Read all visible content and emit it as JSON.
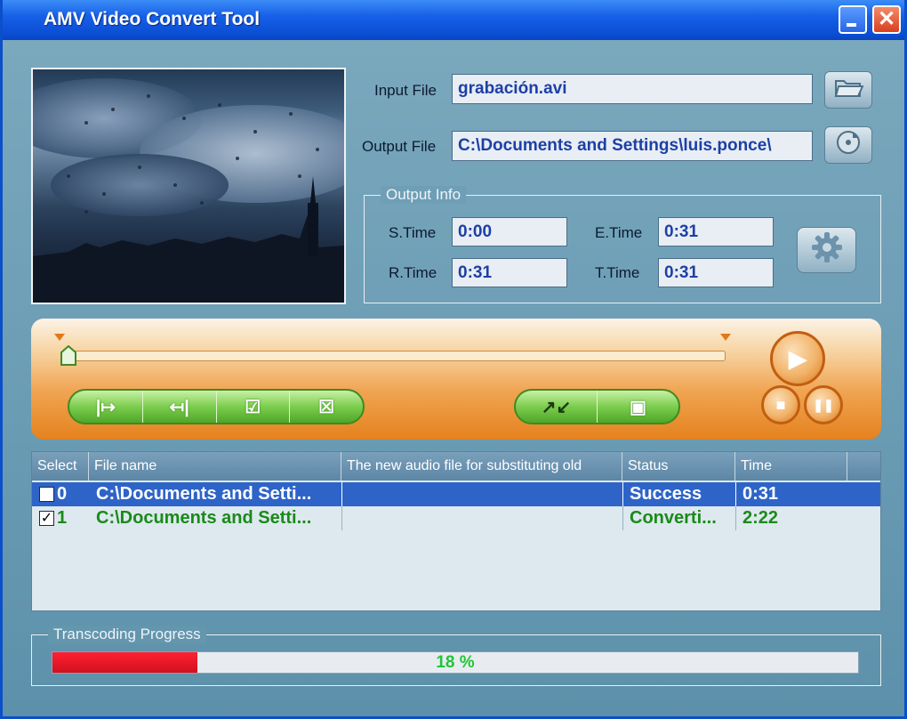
{
  "window": {
    "title": "AMV Video Convert Tool",
    "close_glyph": "✕"
  },
  "files": {
    "input_label": "Input File",
    "input_value": "grabación.avi",
    "output_label": "Output File",
    "output_value": "C:\\Documents and Settings\\luis.ponce\\"
  },
  "icons": {
    "open": "open-folder-icon",
    "save": "save-disc-icon",
    "settings": "gear-icon"
  },
  "output_info": {
    "title": "Output Info",
    "s_time_label": "S.Time",
    "s_time": "0:00",
    "e_time_label": "E.Time",
    "e_time": "0:31",
    "r_time_label": "R.Time",
    "r_time": "0:31",
    "t_time_label": "T.Time",
    "t_time": "0:31"
  },
  "controls": {
    "set_start_glyph": "|↦",
    "set_end_glyph": "↤|",
    "check_all_glyph": "☑",
    "uncheck_all_glyph": "☒",
    "convert_glyph": "↗↙",
    "stop_convert_glyph": "▣",
    "play_glyph": "▶",
    "stop_glyph": "■",
    "pause_glyph": "❚❚"
  },
  "file_list": {
    "columns": [
      "Select",
      "File name",
      "The new audio file for substituting old",
      "Status",
      "Time"
    ],
    "rows": [
      {
        "checked": "",
        "index": "0",
        "file": "C:\\Documents and Setti...",
        "audio": "",
        "status": "Success",
        "time": "0:31"
      },
      {
        "checked": "✓",
        "index": "1",
        "file": "C:\\Documents and Setti...",
        "audio": "",
        "status": "Converti...",
        "time": "2:22"
      }
    ]
  },
  "progress": {
    "title": "Transcoding Progress",
    "value_text": "18 %",
    "fraction": 0.18
  },
  "colors": {
    "row_selected": "#2e64c8",
    "row_text_default": "#1a8a1a",
    "progress_fill": "#e01424",
    "progress_text": "#22c43a"
  }
}
